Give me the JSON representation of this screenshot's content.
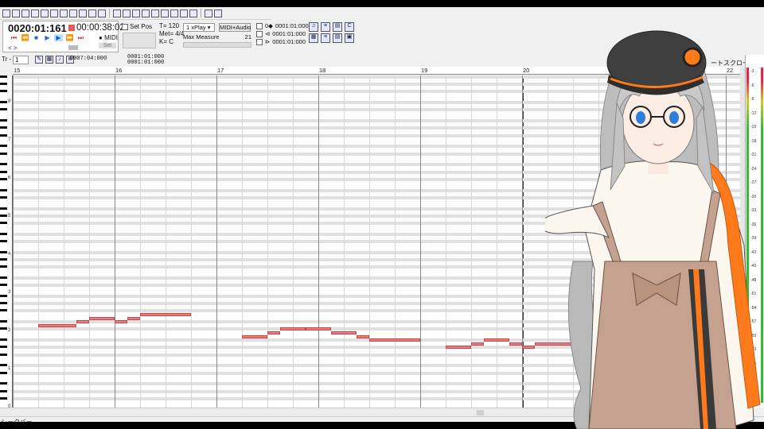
{
  "toolbar": {
    "icons": [
      "new-file-icon",
      "open-file-icon",
      "save-icon",
      "save-as-icon",
      "reload-icon",
      "folder-icon",
      "open-folder-icon",
      "page-icon",
      "list-icon",
      "export-icon",
      "export-midi-icon",
      "undo-icon",
      "redo-icon",
      "cut-icon",
      "copy-icon",
      "paste-icon",
      "delete-icon",
      "select-all-icon",
      "snap-icon",
      "select-list-icon",
      "headphones-icon",
      "piano-icon"
    ]
  },
  "transport": {
    "time_main": "0020:01:161",
    "time_seconds": "00:00:38:02",
    "midi_label": "MIDI",
    "set_label": "Set",
    "arrows": "<   >"
  },
  "setpos": {
    "label": "Set Pos"
  },
  "tempo": {
    "tempo_line": "T= 120",
    "meter_line": "Met= 4/4",
    "key_line": "K= C"
  },
  "playmode": {
    "selected": "1 xPlay",
    "midi_audio": "MIDI+Audio",
    "max_measure_label": "Max Measure",
    "max_measure_value": "21"
  },
  "loops": [
    "0001:01:000",
    "0001:01:000",
    "0001:01:000"
  ],
  "track": {
    "prefix": "Tr -",
    "number": "1"
  },
  "positions": {
    "cursor": "0007:04:000",
    "range_start": "0001:01:000",
    "range_end": "0001:01:000"
  },
  "scroll_label": "ートスクロール",
  "ruler": {
    "measures": [
      "15",
      "16",
      "17",
      "18",
      "19",
      "20",
      "21",
      "22"
    ]
  },
  "octaves": [
    "8",
    "7",
    "6",
    "5",
    "4",
    "3",
    "2",
    "1",
    "0"
  ],
  "meter_labels": [
    "-3",
    "-6",
    "-9",
    "-12",
    "-15",
    "-18",
    "-21",
    "-24",
    "-27",
    "-30",
    "-33",
    "-36",
    "-39",
    "-42",
    "-45",
    "-48",
    "-51",
    "-54",
    "-57",
    "-60",
    "-63",
    "-66",
    "-69",
    "-72"
  ],
  "status": "シークバー",
  "notes": [
    {
      "m": 15.25,
      "len": 0.375,
      "p": 60
    },
    {
      "m": 15.625,
      "len": 0.125,
      "p": 61
    },
    {
      "m": 15.75,
      "len": 0.25,
      "p": 62
    },
    {
      "m": 16.0,
      "len": 0.125,
      "p": 61
    },
    {
      "m": 16.125,
      "len": 0.125,
      "p": 62
    },
    {
      "m": 16.25,
      "len": 0.5,
      "p": 63
    },
    {
      "m": 17.25,
      "len": 0.25,
      "p": 57
    },
    {
      "m": 17.5,
      "len": 0.125,
      "p": 58
    },
    {
      "m": 17.625,
      "len": 0.25,
      "p": 59
    },
    {
      "m": 17.875,
      "len": 0.25,
      "p": 59
    },
    {
      "m": 18.125,
      "len": 0.25,
      "p": 58
    },
    {
      "m": 18.375,
      "len": 0.125,
      "p": 57
    },
    {
      "m": 18.5,
      "len": 0.5,
      "p": 56
    },
    {
      "m": 19.25,
      "len": 0.25,
      "p": 54
    },
    {
      "m": 19.5,
      "len": 0.125,
      "p": 55
    },
    {
      "m": 19.625,
      "len": 0.25,
      "p": 56
    },
    {
      "m": 19.875,
      "len": 0.125,
      "p": 55
    },
    {
      "m": 20.0,
      "len": 0.125,
      "p": 54
    },
    {
      "m": 20.125,
      "len": 0.5,
      "p": 55
    }
  ]
}
